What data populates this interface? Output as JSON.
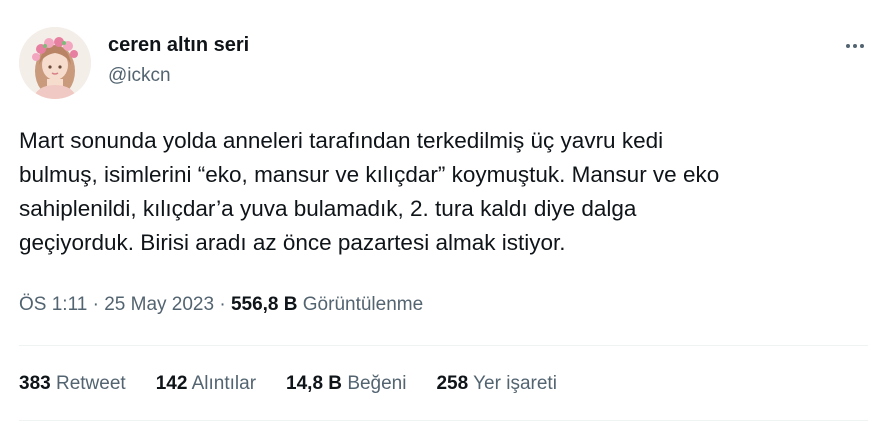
{
  "author": {
    "display_name": "ceren altın seri",
    "handle": "@ickcn"
  },
  "menu_icon": "more-horizontal-icon",
  "tweet": {
    "lines": [
      "Mart sonunda yolda anneleri tarafından terkedilmiş üç yavru kedi",
      "bulmuş, isimlerini “eko, mansur ve kılıçdar” koymuştuk. Mansur ve eko",
      "sahiplenildi, kılıçdar’a yuva bulamadık, 2. tura kaldı diye dalga",
      "geçiyorduk. Birisi aradı az önce pazartesi almak istiyor."
    ]
  },
  "meta": {
    "time": "ÖS 1:11",
    "sep1": "·",
    "date": "25 May 2023",
    "sep2": "·",
    "views_count": "556,8 B",
    "views_label": "Görüntülenme"
  },
  "stats": [
    {
      "count": "383",
      "label": "Retweet"
    },
    {
      "count": "142",
      "label": "Alıntılar"
    },
    {
      "count": "14,8 B",
      "label": "Beğeni"
    },
    {
      "count": "258",
      "label": "Yer işareti"
    }
  ],
  "colors": {
    "text": "#0f1419",
    "secondary": "#536471",
    "divider": "#eff3f4"
  }
}
